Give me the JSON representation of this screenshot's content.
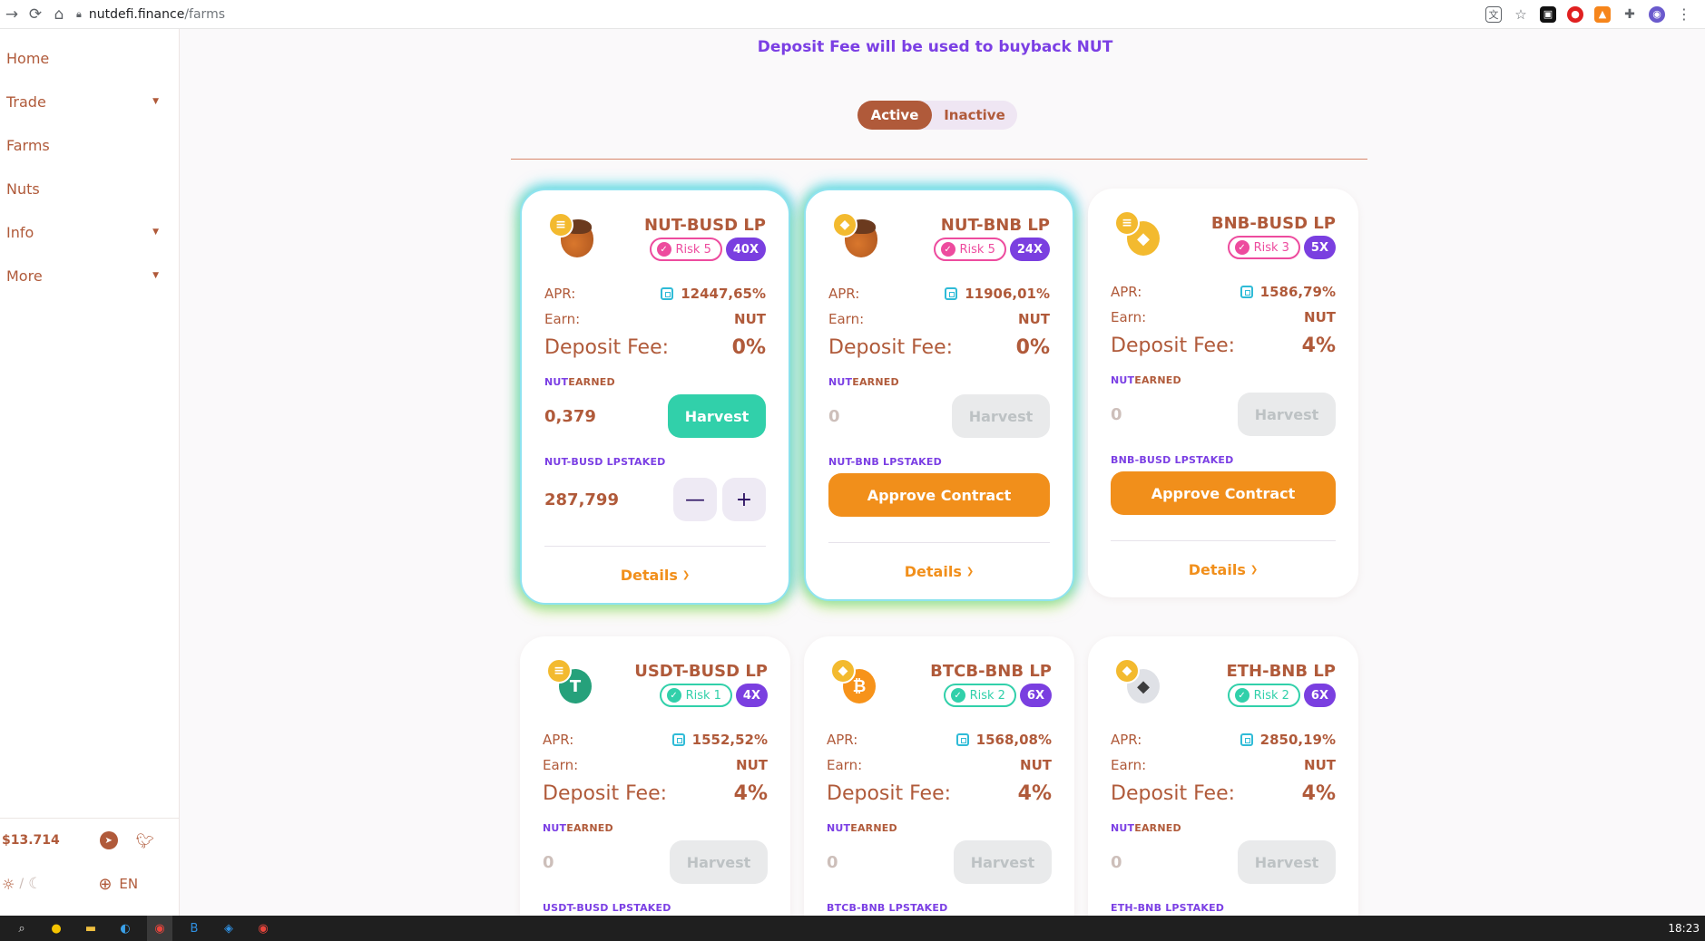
{
  "browser": {
    "url_host": "nutdefi.finance",
    "url_path": "/farms"
  },
  "sidebar": {
    "items": [
      {
        "label": "Home",
        "has_caret": false
      },
      {
        "label": "Trade",
        "has_caret": true
      },
      {
        "label": "Farms",
        "has_caret": false
      },
      {
        "label": "Nuts",
        "has_caret": false
      },
      {
        "label": "Info",
        "has_caret": true
      },
      {
        "label": "More",
        "has_caret": true
      }
    ],
    "price": "$13.714",
    "theme_sep": "/",
    "language": "EN"
  },
  "main": {
    "banner": "Deposit Fee will be used to buyback NUT",
    "tabs": {
      "active": "Active",
      "inactive": "Inactive"
    },
    "labels": {
      "apr": "APR:",
      "earn": "Earn:",
      "deposit_fee": "Deposit Fee:",
      "nut_earned_a": "NUT",
      "nut_earned_b": " EARNED",
      "staked_suffix": " STAKED",
      "harvest": "Harvest",
      "approve": "Approve Contract",
      "details": "Details"
    },
    "farms": [
      {
        "title": "NUT-BUSD LP",
        "risk": "Risk 5",
        "multiplier": "40X",
        "apr": "12447,65%",
        "earn": "NUT",
        "deposit_fee": "0%",
        "earned": "0,379",
        "staked_label": "NUT-BUSD LP",
        "staked": "287,799"
      },
      {
        "title": "NUT-BNB LP",
        "risk": "Risk 5",
        "multiplier": "24X",
        "apr": "11906,01%",
        "earn": "NUT",
        "deposit_fee": "0%",
        "earned": "0",
        "staked_label": "NUT-BNB LP"
      },
      {
        "title": "BNB-BUSD LP",
        "risk": "Risk 3",
        "multiplier": "5X",
        "apr": "1586,79%",
        "earn": "NUT",
        "deposit_fee": "4%",
        "earned": "0",
        "staked_label": "BNB-BUSD LP"
      },
      {
        "title": "USDT-BUSD LP",
        "risk": "Risk 1",
        "multiplier": "4X",
        "apr": "1552,52%",
        "earn": "NUT",
        "deposit_fee": "4%",
        "earned": "0",
        "staked_label": "USDT-BUSD LP"
      },
      {
        "title": "BTCB-BNB LP",
        "risk": "Risk 2",
        "multiplier": "6X",
        "apr": "1568,08%",
        "earn": "NUT",
        "deposit_fee": "4%",
        "earned": "0",
        "staked_label": "BTCB-BNB LP"
      },
      {
        "title": "ETH-BNB LP",
        "risk": "Risk 2",
        "multiplier": "6X",
        "apr": "2850,19%",
        "earn": "NUT",
        "deposit_fee": "4%",
        "earned": "0",
        "staked_label": "ETH-BNB LP"
      }
    ]
  },
  "taskbar": {
    "time": "18:23"
  },
  "colors": {
    "brand": "#b05a3a",
    "accent_purple": "#7b3fe4",
    "harvest_active": "#31d0aa",
    "approve": "#f18f1b",
    "risk_high": "#ed4b9e",
    "risk_low": "#31d0aa"
  }
}
